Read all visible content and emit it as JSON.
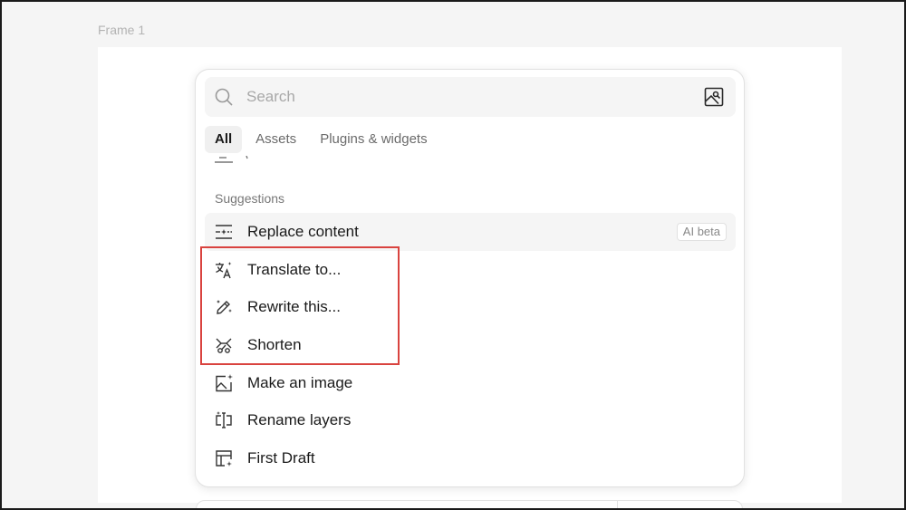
{
  "canvas": {
    "frame_label": "Frame 1"
  },
  "search": {
    "placeholder": "Search"
  },
  "tabs": [
    {
      "label": "All",
      "active": true
    },
    {
      "label": "Assets",
      "active": false
    },
    {
      "label": "Plugins & widgets",
      "active": false
    }
  ],
  "suggestions": {
    "title": "Suggestions",
    "items": [
      {
        "label": "Replace content",
        "icon": "replace-content-icon",
        "badge": "AI beta"
      },
      {
        "label": "Translate to...",
        "icon": "translate-icon"
      },
      {
        "label": "Rewrite this...",
        "icon": "magic-pencil-icon"
      },
      {
        "label": "Shorten",
        "icon": "shorten-icon"
      },
      {
        "label": "Make an image",
        "icon": "image-sparkle-icon"
      },
      {
        "label": "Rename layers",
        "icon": "rename-layers-icon"
      },
      {
        "label": "First Draft",
        "icon": "first-draft-icon"
      }
    ]
  },
  "colors": {
    "highlight": "#d9433f",
    "hover": "#f5f5f5",
    "muted": "#777777"
  }
}
